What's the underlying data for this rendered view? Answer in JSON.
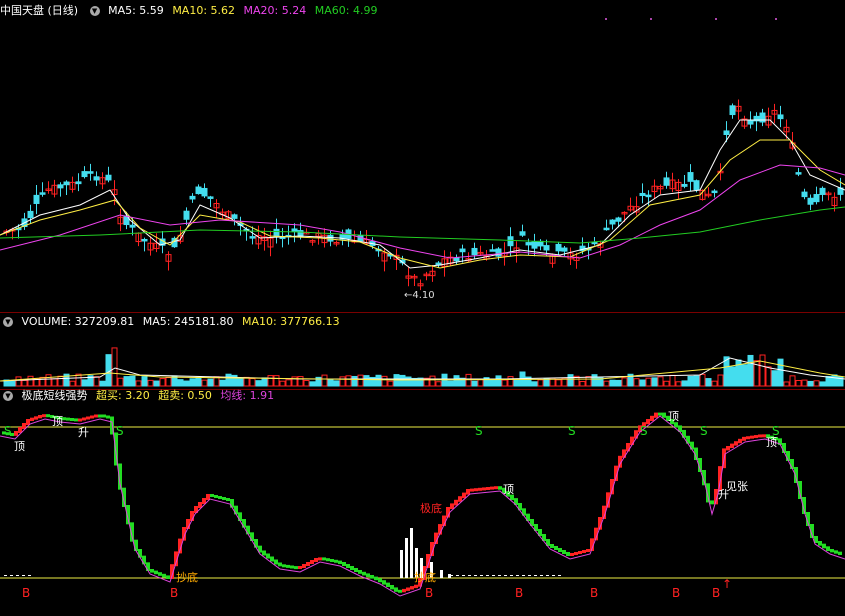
{
  "colors": {
    "up": "#ff2222",
    "down": "#44ddee",
    "ma5": "#ffffff",
    "ma10": "#ffee44",
    "ma20": "#ee44ee",
    "ma60": "#22cc22",
    "green": "#22dd22",
    "yellow": "#eeee44",
    "magenta": "#dd44dd"
  },
  "price": {
    "symbol": "中国天盘 (日线)",
    "ma5": "MA5: 5.59",
    "ma10": "MA10: 5.62",
    "ma20": "MA20: 5.24",
    "ma60": "MA60: 4.99",
    "low_label": "←4.10"
  },
  "volume": {
    "title": "VOLUME: 327209.81",
    "ma5": "MA5: 245181.80",
    "ma10": "MA10: 377766.13"
  },
  "indicator": {
    "name": "极底短线强势",
    "buy": "超买: 3.20",
    "sell": "超卖: 0.50",
    "avg": "均线: 1.91",
    "labels": {
      "ding": "顶",
      "sheng": "升",
      "jidi": "极底",
      "chaodi": "抄底",
      "jianzhang": "见张",
      "s": "S",
      "b": "B"
    }
  },
  "chart_data": [
    {
      "type": "candlestick",
      "panel": "price",
      "series": [
        {
          "name": "MA5"
        },
        {
          "name": "MA10"
        },
        {
          "name": "MA20"
        },
        {
          "name": "MA60"
        }
      ],
      "annotations": [
        "←4.10"
      ]
    },
    {
      "type": "bar",
      "panel": "volume",
      "series": [
        {
          "name": "VOLUME"
        },
        {
          "name": "MA5"
        },
        {
          "name": "MA10"
        }
      ]
    },
    {
      "type": "bar",
      "panel": "indicator",
      "levels": {
        "buy": 3.2,
        "sell": 0.5,
        "avg": 1.91
      },
      "signals": [
        "S",
        "B",
        "顶",
        "升",
        "极底",
        "抄底",
        "见张"
      ]
    }
  ]
}
